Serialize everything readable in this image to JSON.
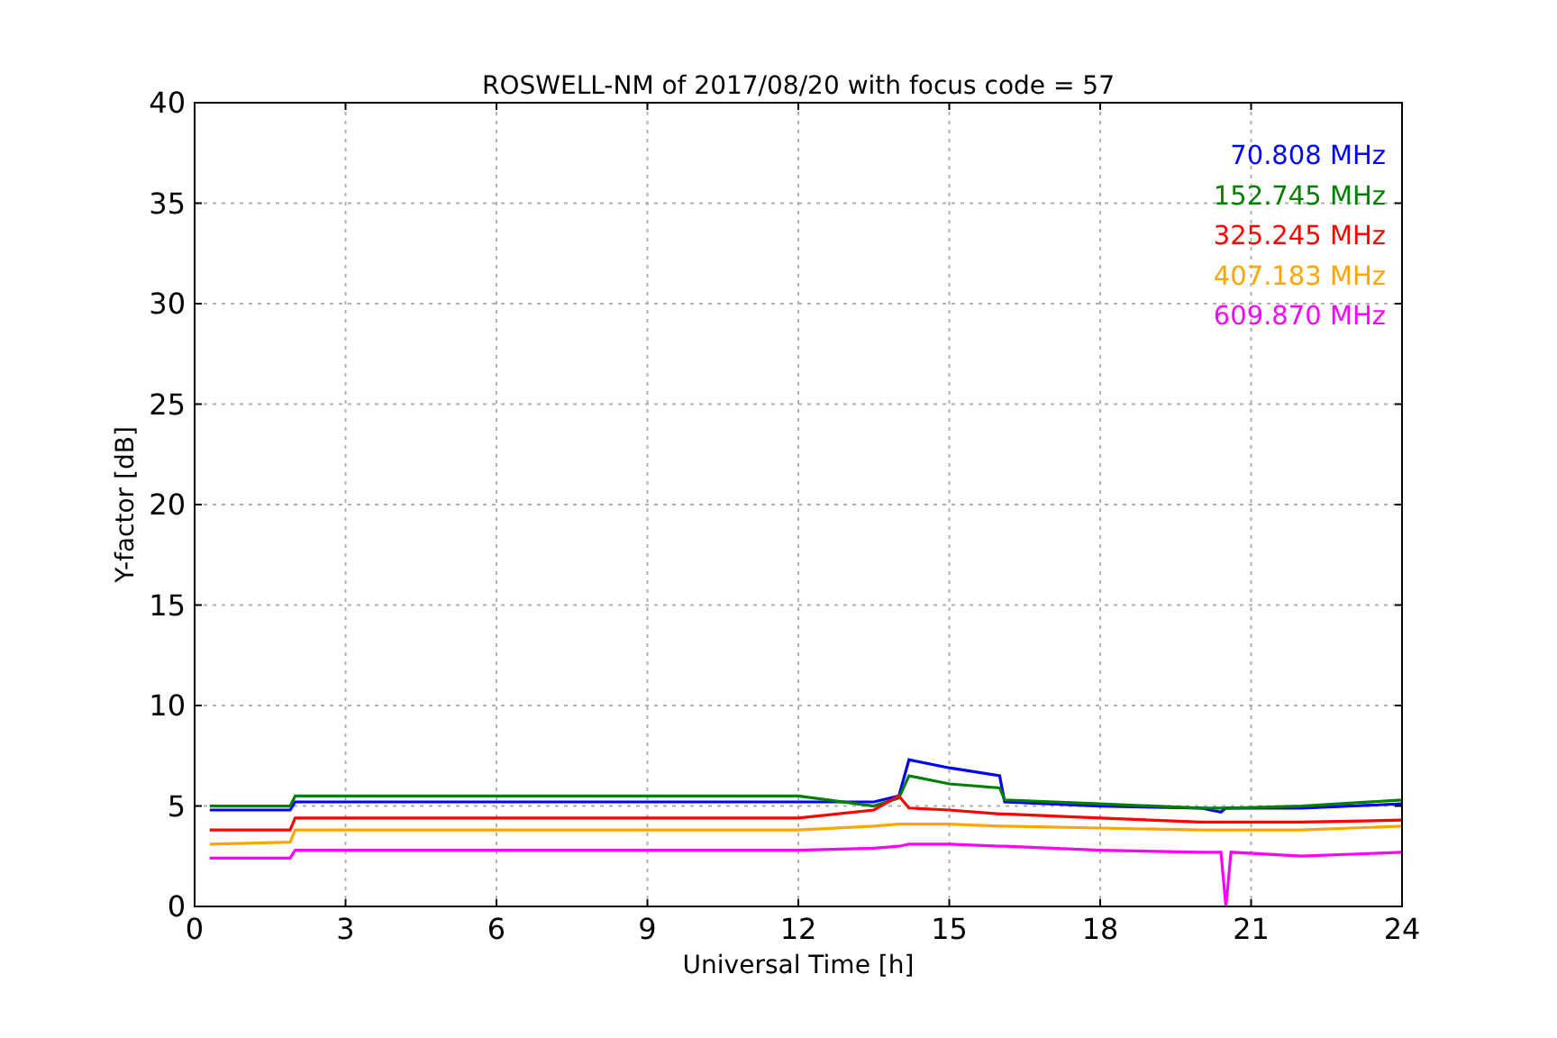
{
  "chart_data": {
    "type": "line",
    "title": "ROSWELL-NM of 2017/08/20 with focus code = 57",
    "xlabel": "Universal Time [h]",
    "ylabel": "Y-factor [dB]",
    "x": [
      0.3,
      1.9,
      2.0,
      12.0,
      13.5,
      14.0,
      14.2,
      15.0,
      16.0,
      16.1,
      18.0,
      20.0,
      20.4,
      20.5,
      20.6,
      22.0,
      24.0
    ],
    "series": [
      {
        "name": "70.808 MHz",
        "color": "#0000ff",
        "values": [
          4.8,
          4.8,
          5.2,
          5.2,
          5.2,
          5.5,
          7.3,
          6.9,
          6.5,
          5.2,
          5.0,
          4.9,
          4.7,
          4.9,
          4.9,
          4.9,
          5.1
        ]
      },
      {
        "name": "152.745 MHz",
        "color": "#008000",
        "values": [
          5.0,
          5.0,
          5.5,
          5.5,
          5.0,
          5.4,
          6.5,
          6.1,
          5.9,
          5.3,
          5.1,
          4.9,
          4.9,
          4.9,
          4.9,
          5.0,
          5.3
        ]
      },
      {
        "name": "325.245 MHz",
        "color": "#ff0000",
        "values": [
          3.8,
          3.8,
          4.4,
          4.4,
          4.8,
          5.5,
          4.9,
          4.8,
          4.6,
          4.6,
          4.4,
          4.2,
          4.2,
          4.2,
          4.2,
          4.2,
          4.3
        ]
      },
      {
        "name": "407.183 MHz",
        "color": "#ffa500",
        "values": [
          3.1,
          3.2,
          3.8,
          3.8,
          4.0,
          4.1,
          4.1,
          4.1,
          4.0,
          4.0,
          3.9,
          3.8,
          3.8,
          3.8,
          3.8,
          3.8,
          4.0
        ]
      },
      {
        "name": "609.870 MHz",
        "color": "#ff00ff",
        "values": [
          2.4,
          2.4,
          2.8,
          2.8,
          2.9,
          3.0,
          3.1,
          3.1,
          3.0,
          3.0,
          2.8,
          2.7,
          2.7,
          0,
          2.7,
          2.5,
          2.7
        ]
      }
    ],
    "xlim": [
      0,
      24
    ],
    "ylim": [
      0,
      40
    ],
    "xticks": [
      0,
      3,
      6,
      9,
      12,
      15,
      18,
      21,
      24
    ],
    "yticks": [
      0,
      5,
      10,
      15,
      20,
      25,
      30,
      35,
      40
    ],
    "grid": true
  }
}
